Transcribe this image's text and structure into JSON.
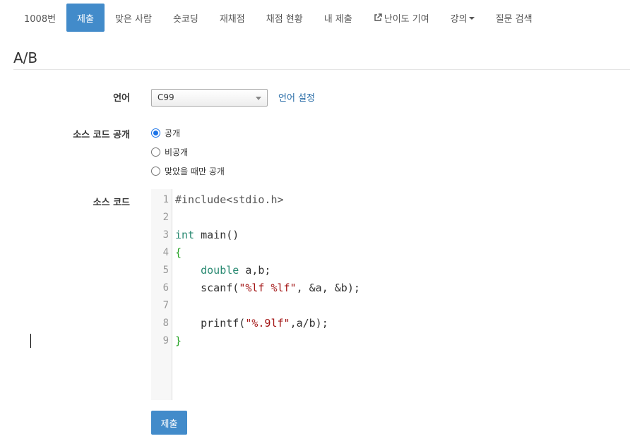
{
  "nav": {
    "tabs": [
      {
        "label": "1008번"
      },
      {
        "label": "제출"
      },
      {
        "label": "맞은 사람"
      },
      {
        "label": "숏코딩"
      },
      {
        "label": "재채점"
      },
      {
        "label": "채점 현황"
      },
      {
        "label": "내 제출"
      },
      {
        "label": "난이도 기여"
      },
      {
        "label": "강의"
      },
      {
        "label": "질문 검색"
      }
    ]
  },
  "page": {
    "title": "A/B"
  },
  "form": {
    "language_label": "언어",
    "language_value": "C99",
    "language_settings_link": "언어 설정",
    "visibility_label": "소스 코드 공개",
    "visibility_options": [
      "공개",
      "비공개",
      "맞았을 때만 공개"
    ],
    "visibility_selected": "공개",
    "source_label": "소스 코드",
    "submit_label": "제출"
  },
  "editor": {
    "line_numbers": [
      "1",
      "2",
      "3",
      "4",
      "5",
      "6",
      "7",
      "8",
      "9"
    ],
    "lines": [
      "#include<stdio.h>",
      "",
      "int main()",
      "{",
      "    double a,b;",
      "    scanf(\"%lf %lf\", &a, &b);",
      "",
      "    printf(\"%.9lf\",a/b);",
      "}"
    ]
  },
  "colors": {
    "accent": "#428bca",
    "link": "#2b6ea8",
    "keyword": "#2a8a72",
    "string": "#a31515",
    "bracket": "#2aa52a"
  }
}
